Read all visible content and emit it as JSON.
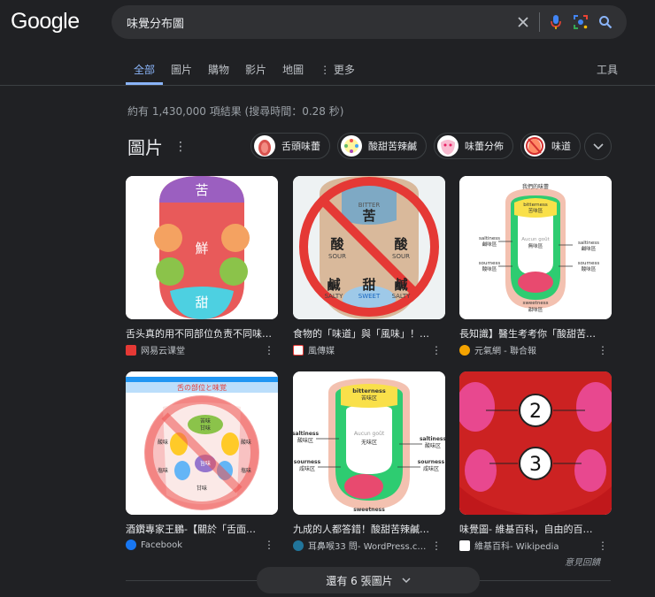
{
  "logo": "Google",
  "search": {
    "query": "味覺分布圖"
  },
  "tabs": [
    "全部",
    "圖片",
    "購物",
    "影片",
    "地圖",
    "更多"
  ],
  "tools": "工具",
  "stats": "約有 1,430,000 項結果 (搜尋時間：0.28 秒)",
  "images_section": {
    "title": "圖片",
    "chips": [
      "舌頭味蕾",
      "酸甜苦辣鹹",
      "味蕾分佈",
      "味道"
    ]
  },
  "cards": [
    {
      "caption": "舌头真的用不同部位负责不同味…",
      "source": "网易云课堂",
      "fav_color": "#e53935",
      "labels": [
        "苦",
        "鮮",
        "甜"
      ]
    },
    {
      "caption": "食物的「味道」與「風味」！…",
      "source": "風傳媒",
      "fav_color": "#ffffff",
      "labels": [
        "BITTER",
        "苦",
        "酸",
        "SOUR",
        "酸",
        "SOUR",
        "鹹",
        "SALTY",
        "甜",
        "SWEET",
        "鹹",
        "SALTY"
      ]
    },
    {
      "caption": "長知識】醫生考考你「酸甜苦…",
      "source": "元氣網 - 聯合報",
      "fav_color": "#f4a300",
      "labels": [
        "我們的味蕾",
        "bitterness",
        "苦味區",
        "saltiness",
        "鹹味區",
        "Aucun goût",
        "無味區",
        "saltiness",
        "鹹味區",
        "sourness",
        "酸味區",
        "sourness",
        "酸味區",
        "sweetness",
        "甜味區"
      ]
    },
    {
      "caption": "酒鑽專家王鵬-【關於「舌面…",
      "source": "Facebook",
      "fav_color": "#1877f2",
      "labels": [
        "舌の部位と味覚",
        "苦味",
        "甘味",
        "酸味",
        "酸味",
        "塩味",
        "塩味",
        "旨味",
        "甘味"
      ]
    },
    {
      "caption": "九成的人都答錯！酸甜苦辣鹹…",
      "source": "耳鼻喉33 問- WordPress.c…",
      "fav_color": "#21759b",
      "labels": [
        "bitterness",
        "苦味区",
        "saltiness",
        "酸味区",
        "Aucun goût",
        "无味区",
        "saltiness",
        "酸味区",
        "sourness",
        "咸味区",
        "sourness",
        "咸味区",
        "sweetness"
      ]
    },
    {
      "caption": "味覺圖- 維基百科，自由的百…",
      "source": "維基百科- Wikipedia",
      "fav_color": "#ffffff",
      "labels": [
        "2",
        "3"
      ]
    }
  ],
  "feedback": "意見回饋",
  "more_button": "還有 6 張圖片"
}
